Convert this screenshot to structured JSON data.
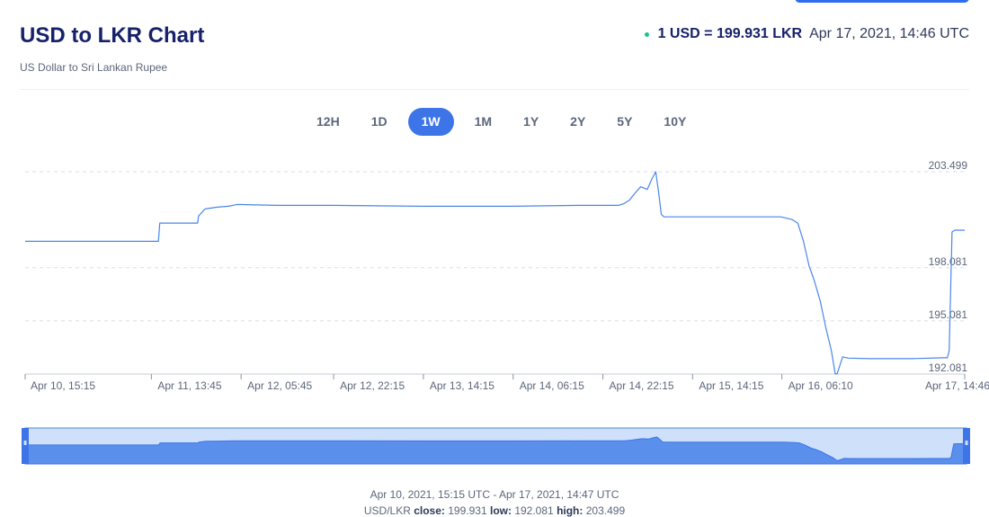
{
  "header": {
    "title": "USD to LKR Chart",
    "subtitle": "US Dollar to Sri Lankan Rupee",
    "rate_text": "1 USD = 199.931 LKR",
    "timestamp": "Apr 17, 2021, 14:46 UTC"
  },
  "range_tabs": [
    {
      "label": "12H",
      "active": false
    },
    {
      "label": "1D",
      "active": false
    },
    {
      "label": "1W",
      "active": true
    },
    {
      "label": "1M",
      "active": false
    },
    {
      "label": "1Y",
      "active": false
    },
    {
      "label": "2Y",
      "active": false
    },
    {
      "label": "5Y",
      "active": false
    },
    {
      "label": "10Y",
      "active": false
    }
  ],
  "colors": {
    "line": "#4a86e8",
    "navigator_fill": "#5b8fec",
    "navigator_bg": "#cfe0fb",
    "active_tab": "#3d75e8",
    "live_dot": "#16c784",
    "title": "#16216a"
  },
  "chart_data": {
    "type": "line",
    "title": "",
    "xlabel": "",
    "ylabel": "",
    "ylim": [
      192.081,
      203.499
    ],
    "y_ticks": [
      "203.499",
      "198.081",
      "195.081",
      "192.081"
    ],
    "x_tick_labels": [
      "Apr 10, 15:15",
      "Apr 11, 13:45",
      "Apr 12, 05:45",
      "Apr 12, 22:15",
      "Apr 13, 14:15",
      "Apr 14, 06:15",
      "Apr 14, 22:15",
      "Apr 15, 14:15",
      "Apr 16, 06:10",
      "Apr 17, 14:46"
    ],
    "grid": "horizontal dashed",
    "x_range": [
      "Apr 10, 2021 15:15",
      "Apr 17, 2021 14:46"
    ],
    "x": [
      "Apr 10 15:15",
      "Apr 11 12:00",
      "Apr 11 15:00",
      "Apr 11 15:15",
      "Apr 11 22:00",
      "Apr 11 22:10",
      "Apr 11 23:20",
      "Apr 12 01:30",
      "Apr 12 03:30",
      "Apr 12 05:00",
      "Apr 12 12:00",
      "Apr 12 22:00",
      "Apr 13 14:00",
      "Apr 14 06:00",
      "Apr 14 18:00",
      "Apr 15 01:00",
      "Apr 15 02:00",
      "Apr 15 03:00",
      "Apr 15 04:00",
      "Apr 15 05:00",
      "Apr 15 06:10",
      "Apr 15 07:00",
      "Apr 15 07:40",
      "Apr 15 08:10",
      "Apr 15 08:40",
      "Apr 15 09:10",
      "Apr 15 09:30",
      "Apr 15 10:00",
      "Apr 15 11:00",
      "Apr 15 14:00",
      "Apr 16 06:00",
      "Apr 16 08:00",
      "Apr 16 09:00",
      "Apr 16 10:00",
      "Apr 16 11:00",
      "Apr 16 12:00",
      "Apr 16 13:00",
      "Apr 16 14:00",
      "Apr 16 15:00",
      "Apr 16 15:40",
      "Apr 16 16:00",
      "Apr 16 17:00",
      "Apr 16 18:00",
      "Apr 16 22:00",
      "Apr 17 05:00",
      "Apr 17 11:00",
      "Apr 17 11:40",
      "Apr 17 12:00",
      "Apr 17 12:30",
      "Apr 17 13:00",
      "Apr 17 14:46"
    ],
    "series": [
      {
        "values": [
          199.57,
          199.57,
          199.57,
          200.6,
          200.6,
          201.0,
          201.4,
          201.5,
          201.55,
          201.65,
          201.6,
          201.6,
          201.55,
          201.55,
          201.6,
          201.6,
          201.7,
          201.9,
          202.3,
          202.65,
          202.5,
          203.1,
          203.499,
          202.4,
          201.1,
          200.95,
          200.95,
          200.95,
          200.95,
          200.95,
          200.95,
          200.8,
          200.6,
          199.6,
          198.2,
          197.3,
          196.2,
          194.7,
          193.4,
          192.1,
          192.081,
          193.05,
          192.98,
          192.95,
          192.95,
          193.0,
          193.0,
          193.4,
          200.1,
          200.2,
          200.2
        ]
      }
    ]
  },
  "footer": {
    "date_range": "Apr 10, 2021, 15:15 UTC - Apr 17, 2021, 14:47 UTC",
    "pair_label": "USD/LKR",
    "close_label": "close:",
    "close_value": "199.931",
    "low_label": "low:",
    "low_value": "192.081",
    "high_label": "high:",
    "high_value": "203.499"
  }
}
